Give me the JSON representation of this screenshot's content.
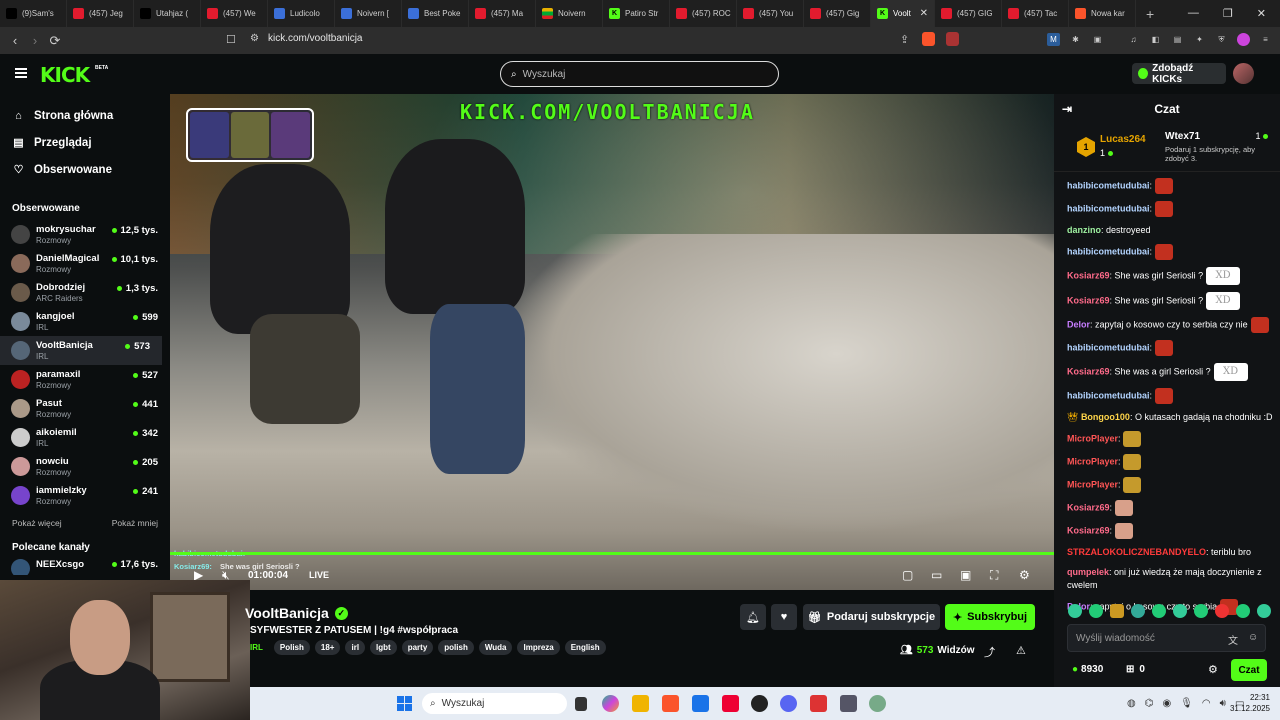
{
  "browser": {
    "tabs": [
      {
        "label": "(9)Sam's",
        "icon": "tiktok-icon"
      },
      {
        "label": "(457) Jeg",
        "icon": "youtube-icon"
      },
      {
        "label": "Utahjaz (",
        "icon": "tiktok-icon"
      },
      {
        "label": "(457) We",
        "icon": "youtube-icon"
      },
      {
        "label": "Ludicolo",
        "icon": "web-icon"
      },
      {
        "label": "Noivern [",
        "icon": "web-icon"
      },
      {
        "label": "Best Poke",
        "icon": "web-icon"
      },
      {
        "label": "(457) Ma",
        "icon": "youtube-icon"
      },
      {
        "label": "Noivern",
        "icon": "flag-icon"
      },
      {
        "label": "Patiro Str",
        "icon": "kick-icon"
      },
      {
        "label": "(457) ROC",
        "icon": "youtube-icon"
      },
      {
        "label": "(457) You",
        "icon": "youtube-icon"
      },
      {
        "label": "(457) Gig",
        "icon": "youtube-icon"
      },
      {
        "label": "Voolt",
        "icon": "kick-icon",
        "active": true
      },
      {
        "label": "(457) GIG",
        "icon": "youtube-icon"
      },
      {
        "label": "(457) Tac",
        "icon": "youtube-icon"
      },
      {
        "label": "Nowa kar",
        "icon": "brave-icon"
      }
    ],
    "url": "kick.com/vooltbanicja"
  },
  "header": {
    "logo": "KICK",
    "beta": "BETA",
    "search_placeholder": "Wyszukaj",
    "kicks_button": "Zdobądź KICKs"
  },
  "sidebar": {
    "nav": [
      {
        "label": "Strona główna",
        "icon": "home-icon"
      },
      {
        "label": "Przeglądaj",
        "icon": "browse-icon"
      },
      {
        "label": "Obserwowane",
        "icon": "heart-icon"
      }
    ],
    "followed_title": "Obserwowane",
    "channels": [
      {
        "name": "mokrysuchar",
        "category": "Rozmowy",
        "viewers": "12,5 tys.",
        "color": "#444"
      },
      {
        "name": "DanielMagical",
        "category": "Rozmowy",
        "viewers": "10,1 tys.",
        "color": "#8a6a5a"
      },
      {
        "name": "Dobrodziej",
        "category": "ARC Raiders",
        "viewers": "1,3 tys.",
        "color": "#6a5a4a"
      },
      {
        "name": "kangjoel",
        "category": "IRL",
        "viewers": "599",
        "color": "#7a8a9a"
      },
      {
        "name": "VooltBanicja",
        "category": "IRL",
        "viewers": "573",
        "color": "#556677",
        "active": true
      },
      {
        "name": "paramaxil",
        "category": "Rozmowy",
        "viewers": "527",
        "color": "#b22"
      },
      {
        "name": "Pasut",
        "category": "Rozmowy",
        "viewers": "441",
        "color": "#a98"
      },
      {
        "name": "aikoiemil",
        "category": "IRL",
        "viewers": "342",
        "color": "#ccc"
      },
      {
        "name": "nowciu",
        "category": "Rozmowy",
        "viewers": "205",
        "color": "#c99"
      },
      {
        "name": "iammielzky",
        "category": "Rozmowy",
        "viewers": "241",
        "color": "#74c"
      }
    ],
    "show_more": "Pokaż więcej",
    "show_less": "Pokaż mniej",
    "recommended_title": "Polecane kanały",
    "recommended": [
      {
        "name": "NEEXcsgo",
        "viewers": "17,6 tys.",
        "color": "#357"
      }
    ]
  },
  "video": {
    "watermark": "KICK.COM/VOOLTBANICJA",
    "time": "01:00:04",
    "live": "LIVE",
    "overlay_chat": [
      {
        "user": "habibicometudubai:",
        "text": ""
      },
      {
        "user": "Kosiarz69:",
        "text": "She was girl Seriosli ?"
      }
    ]
  },
  "channel": {
    "name": "VooltBanicja",
    "title": "SYFWESTER Z PATUSEM | !g4 #współpraca",
    "tag_prefix": "IRL",
    "tags": [
      "Polish",
      "18+",
      "irl",
      "lgbt",
      "party",
      "polish",
      "Wuda",
      "Impreza",
      "English"
    ],
    "gift_label": "Podaruj subskrypcje",
    "subscribe_label": "Subskrybuj",
    "viewers": "573",
    "viewers_label": "Widzów"
  },
  "chat": {
    "title": "Czat",
    "pinned": {
      "rank": "1",
      "top_user": "Lucas264",
      "top_count": "1",
      "gifter": "Wtex71",
      "gifter_count": "1",
      "gifter_desc": "Podaruj 1 subskrypcję, aby zdobyć 3."
    },
    "messages": [
      {
        "user": "habibicometudubai",
        "color": "#b3d4ff",
        "text": "",
        "emote": "red"
      },
      {
        "user": "habibicometudubai",
        "color": "#b3d4ff",
        "text": "",
        "emote": "red"
      },
      {
        "user": "danzino",
        "color": "#9ef0a0",
        "text": "destroyeed",
        "emote": ""
      },
      {
        "user": "habibicometudubai",
        "color": "#b3d4ff",
        "text": "",
        "emote": "red"
      },
      {
        "user": "Kosiarz69",
        "color": "#ff6b8a",
        "text": "She was girl Seriosli ?",
        "emote": "xd"
      },
      {
        "user": "Kosiarz69",
        "color": "#ff6b8a",
        "text": "She was girl Seriosli ?",
        "emote": "xd"
      },
      {
        "user": "Delor",
        "color": "#c77dff",
        "text": "zapytaj o kosowo czy to serbia czy nie",
        "emote": "red"
      },
      {
        "user": "habibicometudubai",
        "color": "#b3d4ff",
        "text": "",
        "emote": "red"
      },
      {
        "user": "Kosiarz69",
        "color": "#ff6b8a",
        "text": "She was a girl Seriosli ?",
        "emote": "xd"
      },
      {
        "user": "habibicometudubai",
        "color": "#b3d4ff",
        "text": "",
        "emote": "red"
      },
      {
        "user": "Bongoo100",
        "color": "#ffd54a",
        "text": "O kutasach gadają na chodniku :D",
        "emote": ""
      },
      {
        "user": "MicroPlayer",
        "color": "#ff5555",
        "text": "",
        "emote": "gold"
      },
      {
        "user": "MicroPlayer",
        "color": "#ff5555",
        "text": "",
        "emote": "gold"
      },
      {
        "user": "MicroPlayer",
        "color": "#ff5555",
        "text": "",
        "emote": "gold"
      },
      {
        "user": "Kosiarz69",
        "color": "#ff6b8a",
        "text": "",
        "emote": "skin"
      },
      {
        "user": "Kosiarz69",
        "color": "#ff6b8a",
        "text": "",
        "emote": "skin"
      },
      {
        "user": "STRZALOKOLICZNEBANDYELO",
        "color": "#ff3b3b",
        "text": "teriblu bro",
        "emote": ""
      },
      {
        "user": "qumpelek",
        "color": "#ff6b8a",
        "text": "oni już wiedzą że mają doczynienie z cwelem",
        "emote": ""
      },
      {
        "user": "Delor",
        "color": "#c77dff",
        "text": "zapytaj o kosowo czy to serbia",
        "emote": "red"
      }
    ],
    "input_placeholder": "Wyślij wiadomość",
    "points": "8930",
    "gifts": "0",
    "send_label": "Czat"
  },
  "taskbar": {
    "search": "Wyszukaj",
    "time": "22:31",
    "date": "31.12.2025"
  }
}
